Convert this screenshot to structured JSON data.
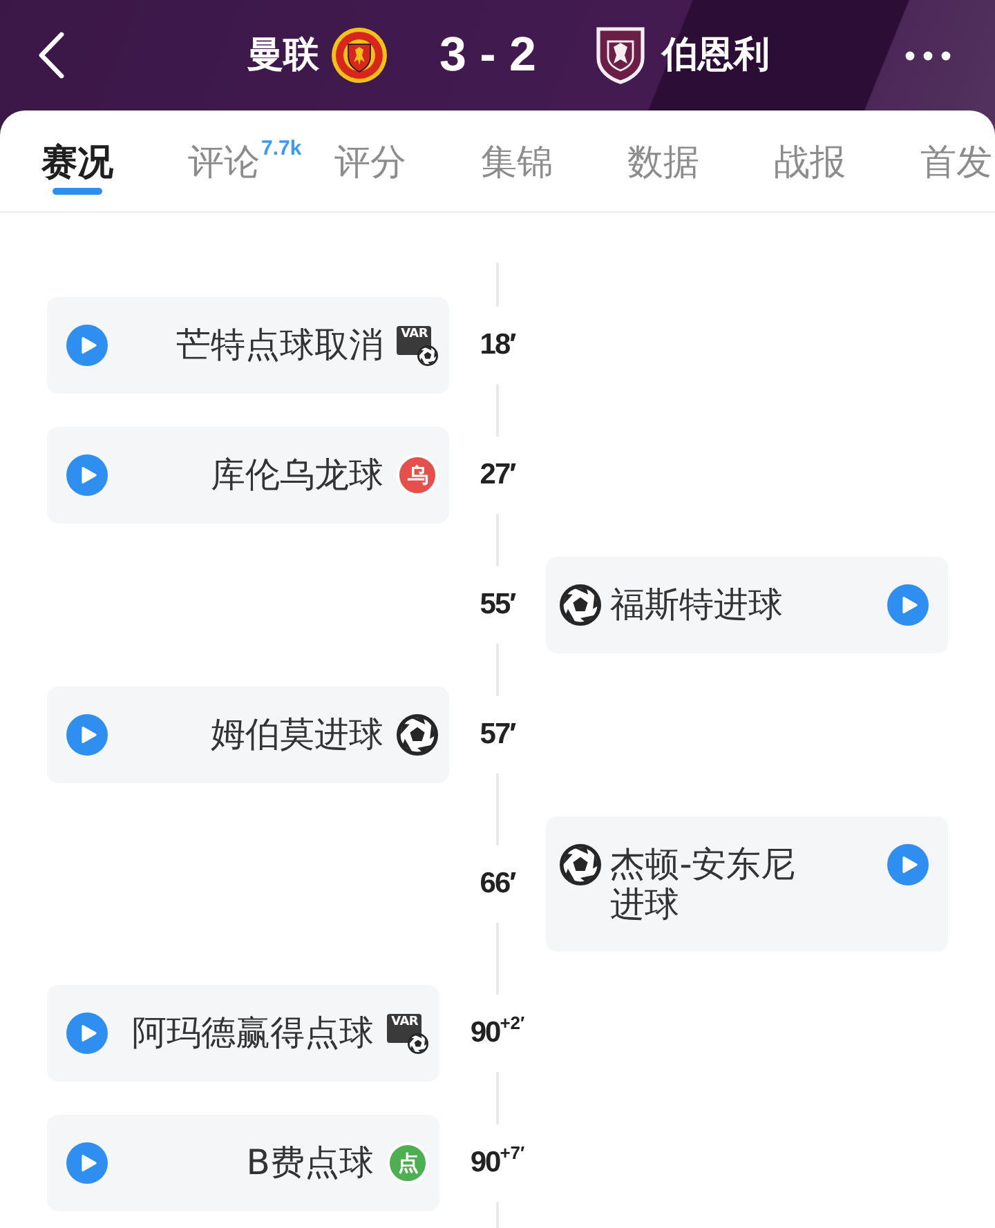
{
  "header": {
    "home_team": "曼联",
    "score": "3 - 2",
    "away_team": "伯恩利"
  },
  "tabs": [
    {
      "label": "赛况",
      "selected": true
    },
    {
      "label": "评论",
      "selected": false,
      "badge": "7.7k"
    },
    {
      "label": "评分",
      "selected": false
    },
    {
      "label": "集锦",
      "selected": false
    },
    {
      "label": "数据",
      "selected": false
    },
    {
      "label": "战报",
      "selected": false
    },
    {
      "label": "首发",
      "selected": false
    }
  ],
  "events": [
    {
      "home": true,
      "kind": "var",
      "text": "芒特点球取消",
      "icon_text": "VAR",
      "minute": "18′"
    },
    {
      "home": true,
      "kind": "own_goal",
      "text": "库伦乌龙球",
      "icon_text": "乌",
      "minute": "27′"
    },
    {
      "home": false,
      "kind": "goal",
      "text": "福斯特进球",
      "minute": "55′"
    },
    {
      "home": true,
      "kind": "goal",
      "text": "姆伯莫进球",
      "minute": "57′"
    },
    {
      "home": false,
      "kind": "goal",
      "text": "杰顿-安东尼进球",
      "minute": "66′"
    },
    {
      "home": true,
      "kind": "var",
      "text": "阿玛德赢得点球",
      "icon_text": "VAR",
      "minute": "90$^{+2′}$"
    },
    {
      "home": true,
      "kind": "penalty",
      "text": "B费点球",
      "icon_text": "点",
      "minute": "90$^{+7′}$"
    }
  ]
}
